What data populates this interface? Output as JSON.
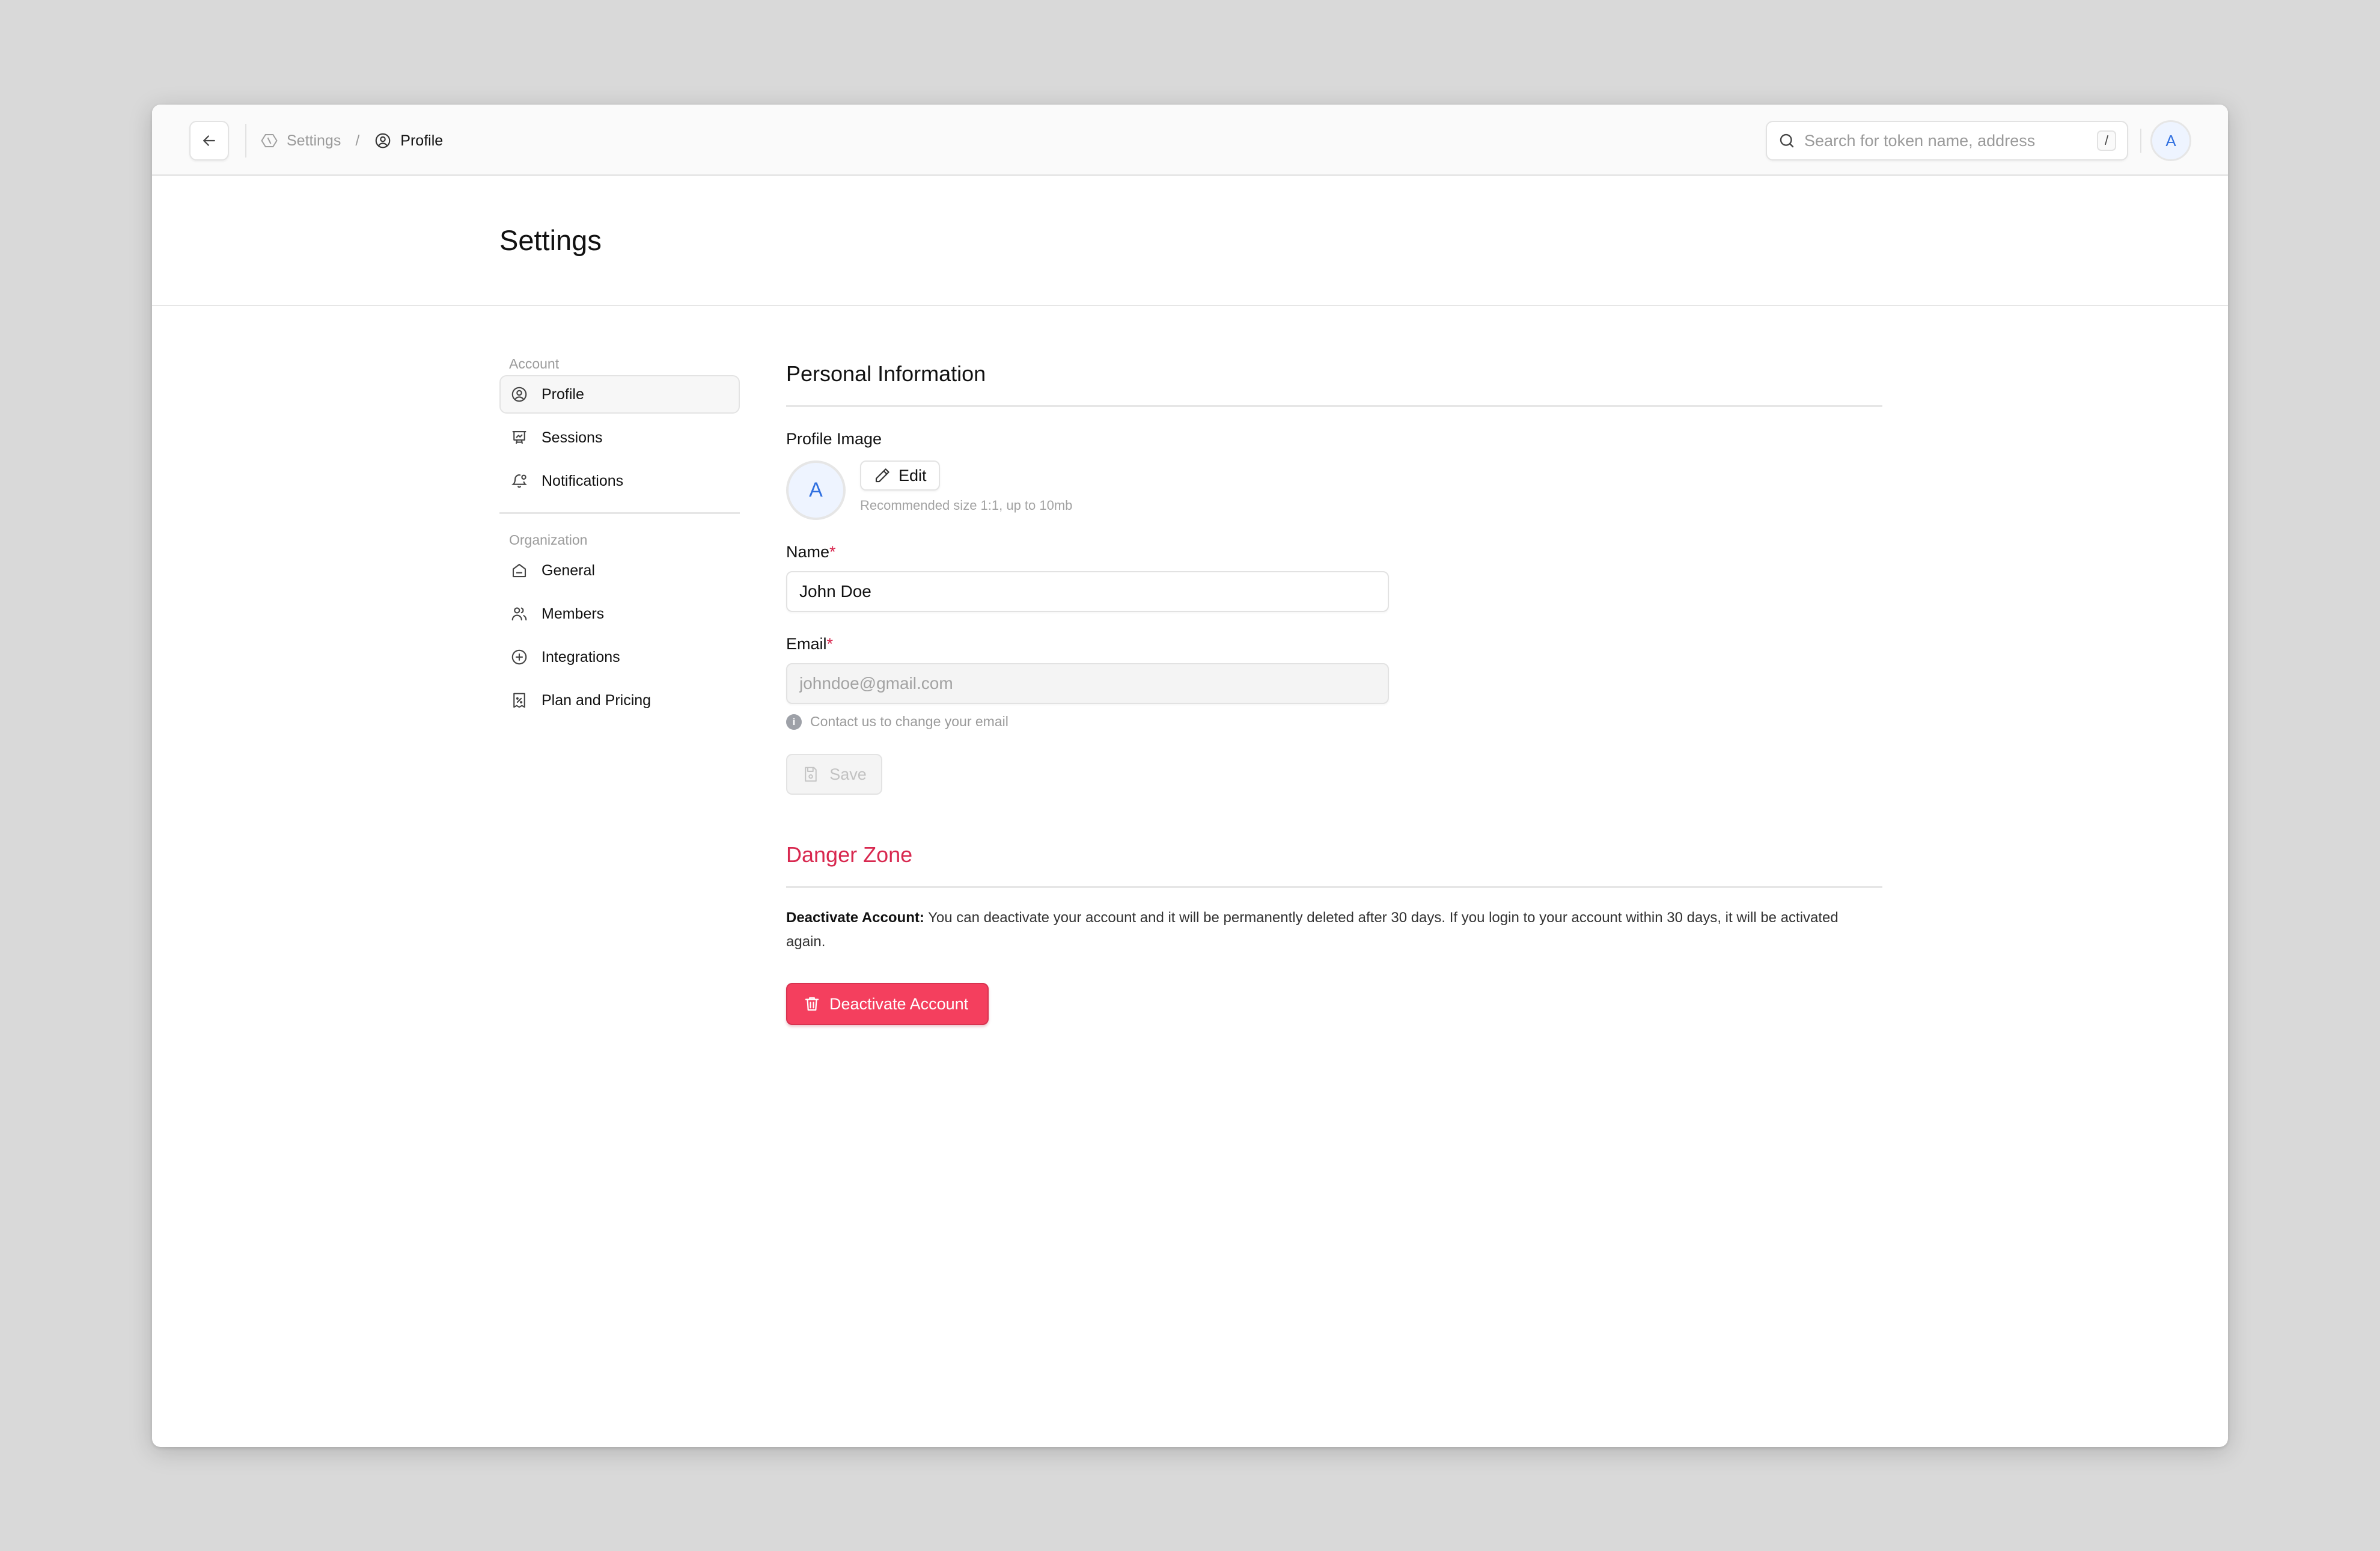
{
  "topbar": {
    "back_icon": "arrow-left-icon",
    "breadcrumbs": [
      {
        "label": "Settings",
        "icon": "hexagon-slash-icon"
      },
      {
        "label": "Profile",
        "icon": "user-circle-icon"
      }
    ],
    "breadcrumb_separator": "/",
    "search": {
      "placeholder": "Search for token name, address",
      "value": "",
      "shortcut": "/"
    },
    "user_avatar_initial": "A"
  },
  "page": {
    "title": "Settings"
  },
  "sidebar": {
    "groups": [
      {
        "label": "Account",
        "items": [
          {
            "label": "Profile",
            "icon": "user-circle-icon",
            "active": true
          },
          {
            "label": "Sessions",
            "icon": "presentation-chart-icon"
          },
          {
            "label": "Notifications",
            "icon": "bell-dot-icon"
          }
        ]
      },
      {
        "label": "Organization",
        "items": [
          {
            "label": "General",
            "icon": "home-icon"
          },
          {
            "label": "Members",
            "icon": "users-icon"
          },
          {
            "label": "Integrations",
            "icon": "plus-circle-icon"
          },
          {
            "label": "Plan and Pricing",
            "icon": "receipt-percent-icon"
          }
        ]
      }
    ]
  },
  "personal": {
    "title": "Personal Information",
    "profile_image_label": "Profile Image",
    "avatar_initial": "A",
    "edit_label": "Edit",
    "image_hint": "Recommended size 1:1, up to 10mb",
    "name_label": "Name",
    "name_value": "John Doe",
    "email_label": "Email",
    "email_value": "johndoe@gmail.com",
    "email_help": "Contact us to change your email",
    "required_mark": "*",
    "save_label": "Save"
  },
  "danger": {
    "title": "Danger Zone",
    "text_bold": "Deactivate Account:",
    "text": " You can deactivate your account and it will be permanently deleted after 30 days. If you login to your account within 30 days, it will be activated again.",
    "button_label": "Deactivate Account",
    "color": "#f43f5e"
  }
}
